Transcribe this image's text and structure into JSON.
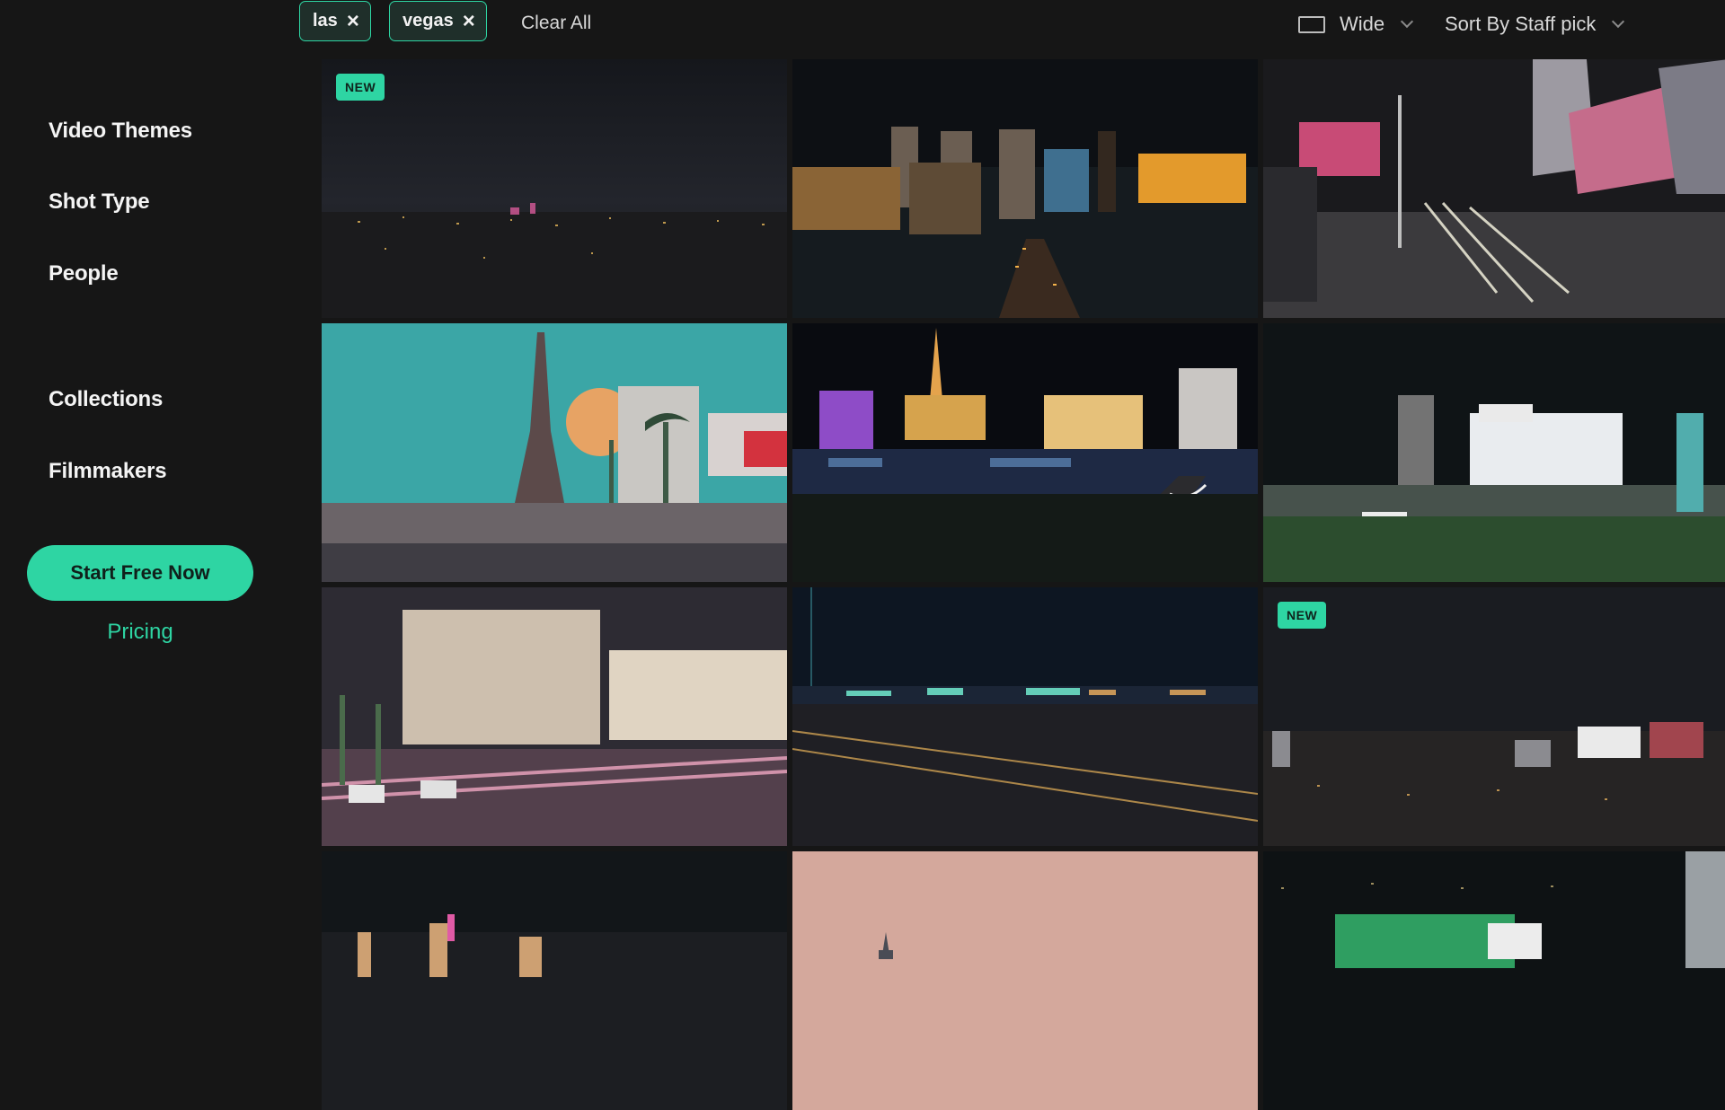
{
  "sidebar": {
    "nav": [
      "Video Themes",
      "Shot Type",
      "People",
      "Collections",
      "Filmmakers"
    ],
    "cta_label": "Start Free Now",
    "pricing_label": "Pricing"
  },
  "filters": {
    "chips": [
      "las",
      "vegas"
    ],
    "clear_all_label": "Clear All",
    "aspect_label": "Wide",
    "sort_label": "Sort By Staff pick"
  },
  "grid": {
    "badge_label": "NEW"
  },
  "colors": {
    "accent": "#2ed5a3",
    "background": "#161616"
  },
  "icons": {
    "chip_remove": "close-icon",
    "aspect": "aspect-ratio-icon",
    "dropdown": "chevron-down-icon"
  }
}
